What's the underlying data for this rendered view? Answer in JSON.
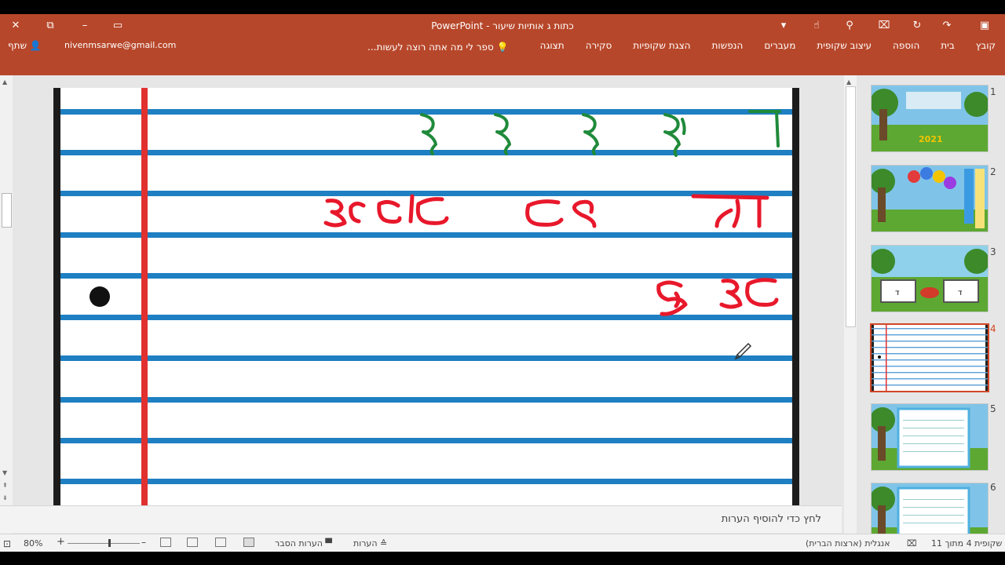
{
  "window": {
    "title": "כתות  ג אותיות  שיעור - PowerPoint",
    "close": "✕",
    "minimize": "–",
    "restore": "⧉",
    "ribbon_display": "▭",
    "undo": "↶",
    "redo": "↷",
    "save": "💾",
    "customize": "▾"
  },
  "account": {
    "share_label": "שתף",
    "email": "nivenmsarwe@gmail.com"
  },
  "tell_me": {
    "text": "ספר לי מה אתה רוצה לעשות..."
  },
  "ribbon": {
    "tabs": [
      "קובץ",
      "בית",
      "הוספה",
      "עיצוב שקופית",
      "מעברים",
      "הנפשות",
      "הצגת שקופיות",
      "סקירה",
      "תצוגה"
    ]
  },
  "slide": {
    "row1_text": "ג ג ג ג ד",
    "row2_text": "דג   גג   גוגג",
    "row3_text": "גגה"
  },
  "thumbnails": {
    "numbers": [
      "1",
      "2",
      "3",
      "4",
      "5",
      "6"
    ],
    "slide1_year": "2021",
    "slide3_left_letter": "ד",
    "slide3_right_letter": "ד"
  },
  "notes": {
    "placeholder": "לחץ כדי להוסיף הערות"
  },
  "status": {
    "slide_info": "שקופית 4 מתוך 11",
    "language": "אנגלית (ארצות הברית)",
    "notes_label": "הערות",
    "comments_label": "הערות הסבר",
    "zoom": "80%",
    "zoom_minus": "–",
    "zoom_plus": "+"
  },
  "colors": {
    "accent": "#b7472a",
    "line_blue": "#1e7fc2",
    "margin_red": "#e03030",
    "ink_green": "#1f8a3a",
    "ink_red": "#e8182b"
  }
}
